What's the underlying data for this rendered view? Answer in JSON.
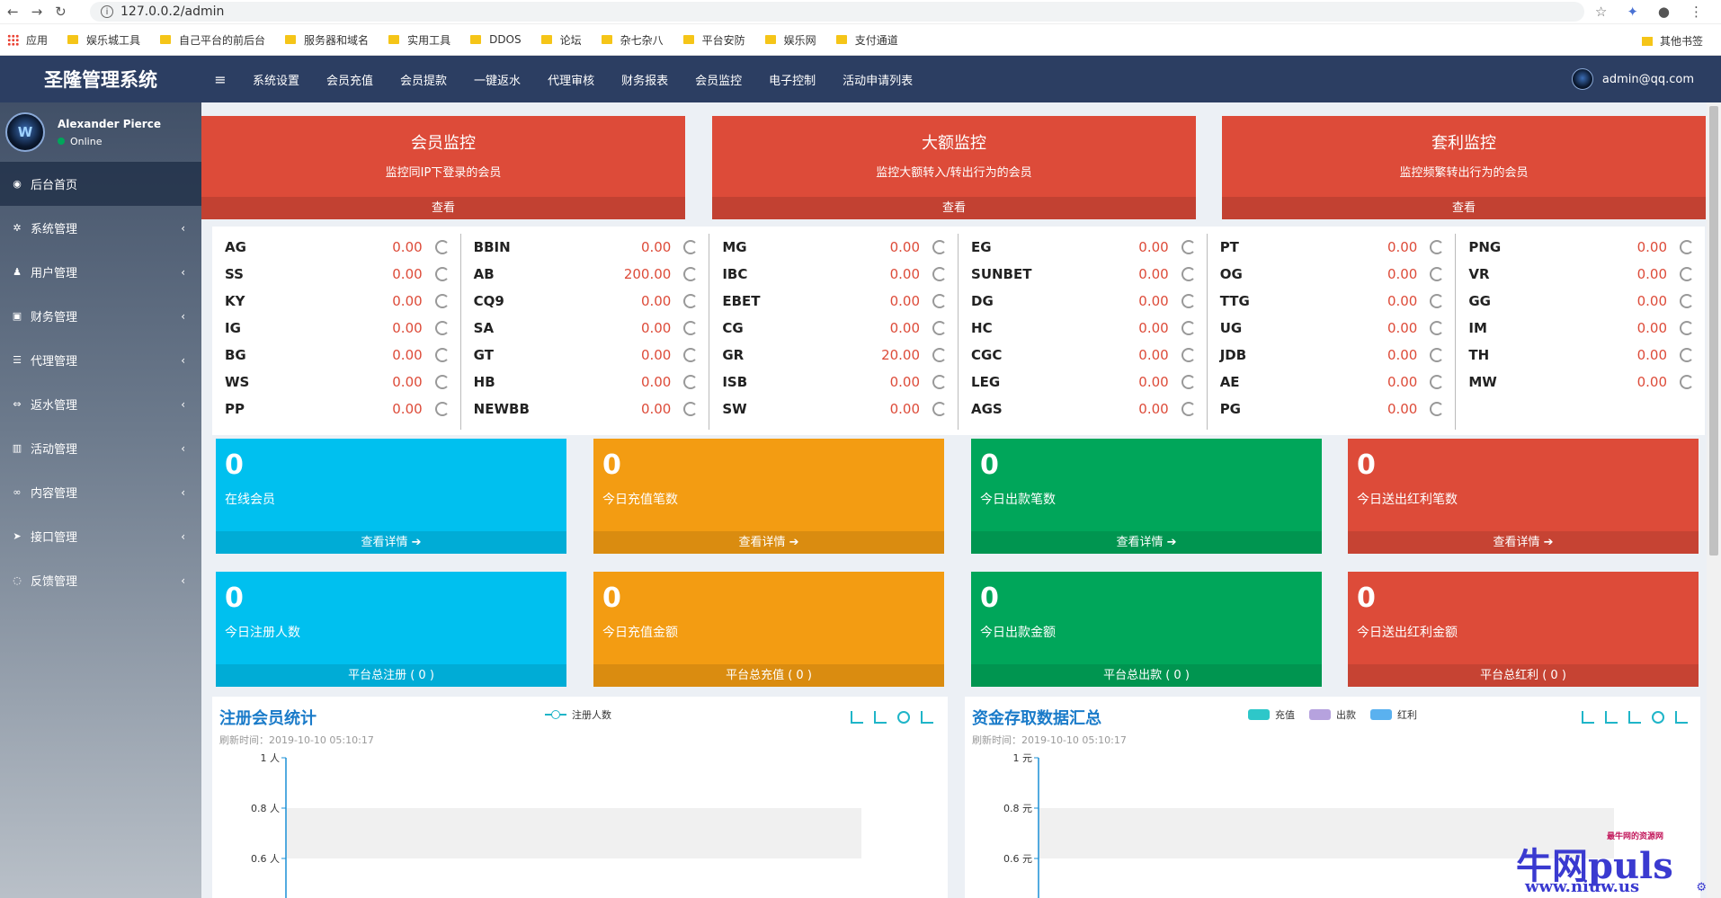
{
  "browser": {
    "url": "127.0.0.2/admin",
    "bookmarks": [
      "应用",
      "娱乐城工具",
      "自己平台的前后台",
      "服务器和域名",
      "实用工具",
      "DDOS",
      "论坛",
      "杂七杂八",
      "平台安防",
      "娱乐网",
      "支付通道"
    ],
    "other_bookmarks": "其他书签"
  },
  "app": {
    "title": "圣隆管理系统",
    "user_name": "Alexander Pierce",
    "user_status": "Online",
    "admin_email": "admin@qq.com"
  },
  "sidebar": {
    "items": [
      {
        "label": "后台首页",
        "icon": "dashboard-icon"
      },
      {
        "label": "系统管理",
        "icon": "gear-icon"
      },
      {
        "label": "用户管理",
        "icon": "users-icon"
      },
      {
        "label": "财务管理",
        "icon": "money-icon"
      },
      {
        "label": "代理管理",
        "icon": "list-icon"
      },
      {
        "label": "返水管理",
        "icon": "exchange-icon"
      },
      {
        "label": "活动管理",
        "icon": "map-icon"
      },
      {
        "label": "内容管理",
        "icon": "link-icon"
      },
      {
        "label": "接口管理",
        "icon": "send-icon"
      },
      {
        "label": "反馈管理",
        "icon": "comment-icon"
      }
    ]
  },
  "topmenu": [
    "系统设置",
    "会员充值",
    "会员提款",
    "一键返水",
    "代理审核",
    "财务报表",
    "会员监控",
    "电子控制",
    "活动申请列表"
  ],
  "monitors": [
    {
      "title": "会员监控",
      "subtitle": "监控同IP下登录的会员",
      "action": "查看"
    },
    {
      "title": "大额监控",
      "subtitle": "监控大额转入/转出行为的会员",
      "action": "查看"
    },
    {
      "title": "套利监控",
      "subtitle": "监控频繁转出行为的会员",
      "action": "查看"
    }
  ],
  "balances": [
    [
      {
        "name": "AG",
        "value": "0.00"
      },
      {
        "name": "SS",
        "value": "0.00"
      },
      {
        "name": "KY",
        "value": "0.00"
      },
      {
        "name": "IG",
        "value": "0.00"
      },
      {
        "name": "BG",
        "value": "0.00"
      },
      {
        "name": "WS",
        "value": "0.00"
      },
      {
        "name": "PP",
        "value": "0.00"
      }
    ],
    [
      {
        "name": "BBIN",
        "value": "0.00"
      },
      {
        "name": "AB",
        "value": "200.00"
      },
      {
        "name": "CQ9",
        "value": "0.00"
      },
      {
        "name": "SA",
        "value": "0.00"
      },
      {
        "name": "GT",
        "value": "0.00"
      },
      {
        "name": "HB",
        "value": "0.00"
      },
      {
        "name": "NEWBB",
        "value": "0.00"
      }
    ],
    [
      {
        "name": "MG",
        "value": "0.00"
      },
      {
        "name": "IBC",
        "value": "0.00"
      },
      {
        "name": "EBET",
        "value": "0.00"
      },
      {
        "name": "CG",
        "value": "0.00"
      },
      {
        "name": "GR",
        "value": "20.00"
      },
      {
        "name": "ISB",
        "value": "0.00"
      },
      {
        "name": "SW",
        "value": "0.00"
      }
    ],
    [
      {
        "name": "EG",
        "value": "0.00"
      },
      {
        "name": "SUNBET",
        "value": "0.00"
      },
      {
        "name": "DG",
        "value": "0.00"
      },
      {
        "name": "HC",
        "value": "0.00"
      },
      {
        "name": "CGC",
        "value": "0.00"
      },
      {
        "name": "LEG",
        "value": "0.00"
      },
      {
        "name": "AGS",
        "value": "0.00"
      }
    ],
    [
      {
        "name": "PT",
        "value": "0.00"
      },
      {
        "name": "OG",
        "value": "0.00"
      },
      {
        "name": "TTG",
        "value": "0.00"
      },
      {
        "name": "UG",
        "value": "0.00"
      },
      {
        "name": "JDB",
        "value": "0.00"
      },
      {
        "name": "AE",
        "value": "0.00"
      },
      {
        "name": "PG",
        "value": "0.00"
      }
    ],
    [
      {
        "name": "PNG",
        "value": "0.00"
      },
      {
        "name": "VR",
        "value": "0.00"
      },
      {
        "name": "GG",
        "value": "0.00"
      },
      {
        "name": "IM",
        "value": "0.00"
      },
      {
        "name": "TH",
        "value": "0.00"
      },
      {
        "name": "MW",
        "value": "0.00"
      }
    ]
  ],
  "stats": [
    {
      "num": "0",
      "label": "在线会员",
      "footer": "查看详情",
      "color": "aqua"
    },
    {
      "num": "0",
      "label": "今日充值笔数",
      "footer": "查看详情",
      "color": "yellow"
    },
    {
      "num": "0",
      "label": "今日出款笔数",
      "footer": "查看详情",
      "color": "green"
    },
    {
      "num": "0",
      "label": "今日送出红利笔数",
      "footer": "查看详情",
      "color": "red"
    },
    {
      "num": "0",
      "label": "今日注册人数",
      "footer": "平台总注册 ( 0 )",
      "color": "aqua"
    },
    {
      "num": "0",
      "label": "今日充值金额",
      "footer": "平台总充值 ( 0 )",
      "color": "yellow"
    },
    {
      "num": "0",
      "label": "今日出款金额",
      "footer": "平台总出款 ( 0 )",
      "color": "green"
    },
    {
      "num": "0",
      "label": "今日送出红利金额",
      "footer": "平台总红利 ( 0 )",
      "color": "red"
    }
  ],
  "charts": {
    "members": {
      "title": "注册会员统计",
      "refresh": "刷新时间：2019-10-10 05:10:17",
      "legend": [
        "注册人数"
      ],
      "ticks": [
        "1 人",
        "0.8 人",
        "0.6 人"
      ]
    },
    "funds": {
      "title": "资金存取数据汇总",
      "refresh": "刷新时间：2019-10-10 05:10:17",
      "legend": [
        "充值",
        "出款",
        "红利"
      ],
      "legend_colors": [
        "#2ec7c9",
        "#b6a2de",
        "#5ab1ef"
      ],
      "ticks": [
        "1 元",
        "0.8 元",
        "0.6 元"
      ]
    }
  },
  "chart_data": [
    {
      "type": "line",
      "title": "注册会员统计",
      "series": [
        {
          "name": "注册人数",
          "values": []
        }
      ],
      "ylim": [
        0,
        1
      ],
      "yticks": [
        "1 人",
        "0.8 人",
        "0.6 人"
      ]
    },
    {
      "type": "bar",
      "title": "资金存取数据汇总",
      "series": [
        {
          "name": "充值",
          "values": []
        },
        {
          "name": "出款",
          "values": []
        },
        {
          "name": "红利",
          "values": []
        }
      ],
      "ylim": [
        0,
        1
      ],
      "yticks": [
        "1 元",
        "0.8 元",
        "0.6 元"
      ]
    }
  ],
  "watermark": {
    "brand": "牛网puls",
    "slogan": "最牛网的资源网",
    "url": "www.niuw.us"
  }
}
